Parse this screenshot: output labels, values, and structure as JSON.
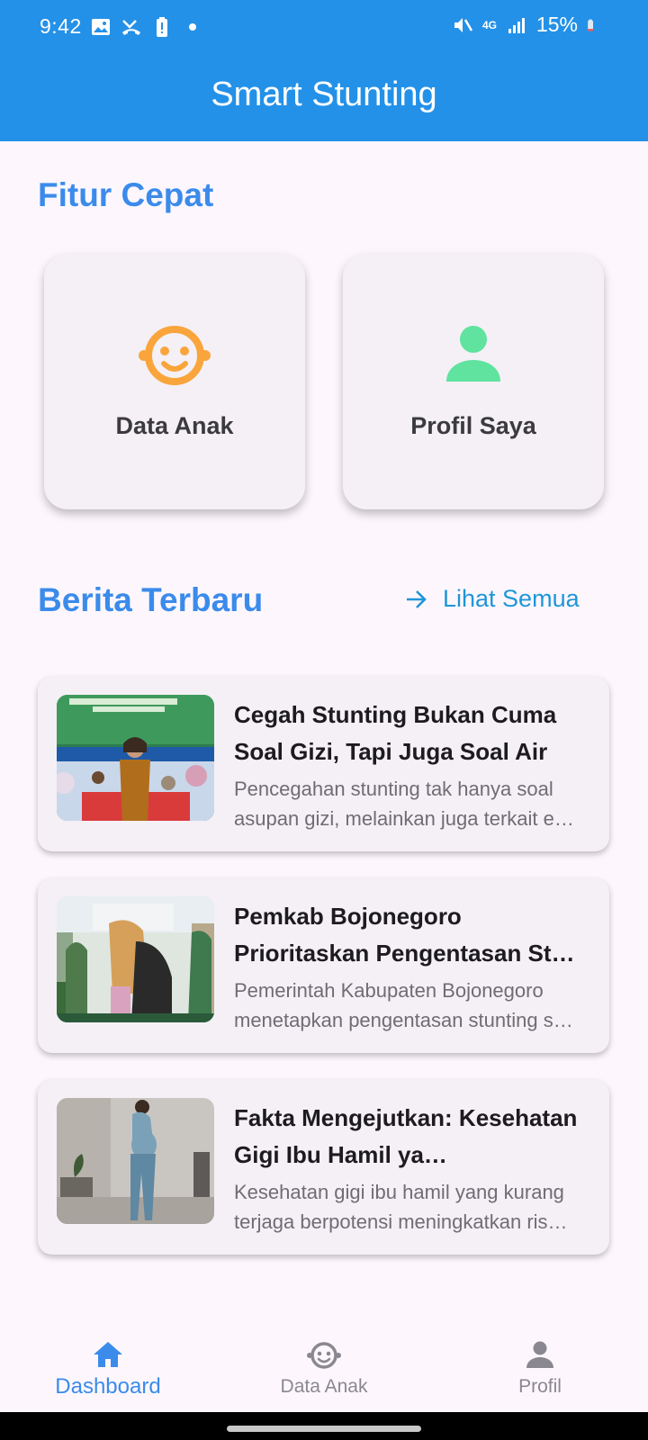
{
  "status_bar": {
    "time": "9:42",
    "network": "4G",
    "battery": "15%"
  },
  "app_bar": {
    "title": "Smart Stunting"
  },
  "quick_features": {
    "title": "Fitur Cepat",
    "items": [
      {
        "label": "Data Anak",
        "icon": "baby-face-icon",
        "color": "#f9a53c"
      },
      {
        "label": "Profil Saya",
        "icon": "person-icon",
        "color": "#5fe39e"
      }
    ]
  },
  "news": {
    "title": "Berita Terbaru",
    "see_all": "Lihat Semua",
    "items": [
      {
        "title": "Cegah Stunting Bukan Cuma Soal Gizi, Tapi Juga Soal Air",
        "summary": "Pencegahan stunting tak hanya soal asupan gizi, melainkan juga terkait e…"
      },
      {
        "title": "Pemkab Bojonegoro Prioritaskan Pengentasan St…",
        "summary": "Pemerintah Kabupaten Bojonegoro menetapkan pengentasan stunting s…"
      },
      {
        "title": "Fakta Mengejutkan: Kesehatan Gigi Ibu Hamil ya…",
        "summary": "Kesehatan gigi ibu hamil yang kurang terjaga berpotensi meningkatkan ris…"
      }
    ]
  },
  "bottom_nav": {
    "items": [
      {
        "label": "Dashboard",
        "icon": "home-icon",
        "active": true
      },
      {
        "label": "Data Anak",
        "icon": "baby-face-icon",
        "active": false
      },
      {
        "label": "Profil",
        "icon": "person-icon",
        "active": false
      }
    ]
  },
  "colors": {
    "primary": "#2491e8",
    "heading": "#3b8beb",
    "link": "#1f96d8",
    "background": "#fdf7fd",
    "card": "#f4f0f6"
  }
}
